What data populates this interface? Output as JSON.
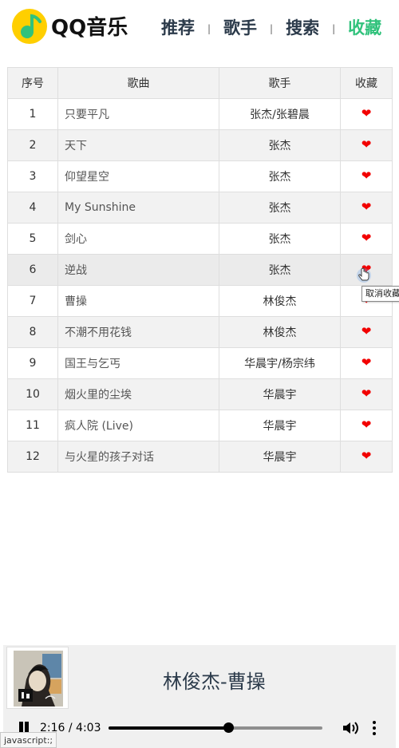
{
  "header": {
    "brand": "QQ音乐",
    "nav": [
      {
        "label": "推荐",
        "active": false
      },
      {
        "label": "歌手",
        "active": false
      },
      {
        "label": "搜索",
        "active": false
      },
      {
        "label": "收藏",
        "active": true
      }
    ],
    "separator": "|"
  },
  "colors": {
    "accent": "#31c27c",
    "heart": "#f20000",
    "nav_text": "#2b3a4a",
    "logo_yellow": "#ffcf00",
    "logo_green": "#31c27c"
  },
  "table": {
    "headers": [
      "序号",
      "歌曲",
      "歌手",
      "收藏"
    ],
    "rows": [
      {
        "no": "1",
        "song": "只要平凡",
        "artist": "张杰/张碧晨",
        "fav": "❤"
      },
      {
        "no": "2",
        "song": "天下",
        "artist": "张杰",
        "fav": "❤"
      },
      {
        "no": "3",
        "song": "仰望星空",
        "artist": "张杰",
        "fav": "❤"
      },
      {
        "no": "4",
        "song": "My Sunshine",
        "artist": "张杰",
        "fav": "❤"
      },
      {
        "no": "5",
        "song": "剑心",
        "artist": "张杰",
        "fav": "❤"
      },
      {
        "no": "6",
        "song": "逆战",
        "artist": "张杰",
        "fav": "❤"
      },
      {
        "no": "7",
        "song": "曹操",
        "artist": "林俊杰",
        "fav": "❤"
      },
      {
        "no": "8",
        "song": "不潮不用花钱",
        "artist": "林俊杰",
        "fav": "❤"
      },
      {
        "no": "9",
        "song": "国王与乞丐",
        "artist": "华晨宇/杨宗纬",
        "fav": "❤"
      },
      {
        "no": "10",
        "song": "烟火里的尘埃",
        "artist": "华晨宇",
        "fav": "❤"
      },
      {
        "no": "11",
        "song": "疯人院 (Live)",
        "artist": "华晨宇",
        "fav": "❤"
      },
      {
        "no": "12",
        "song": "与火星的孩子对话",
        "artist": "华晨宇",
        "fav": "❤"
      }
    ],
    "hover_row_index": 5
  },
  "tooltip": {
    "text": "取消收藏"
  },
  "player": {
    "now_playing": "林俊杰-曹操",
    "time": "2:16 / 4:03",
    "progress": 0.56,
    "state": "playing"
  },
  "status_bar": {
    "url": "javascript:;"
  },
  "icons": {
    "logo": "qq-music-logo-icon",
    "pause": "pause-icon",
    "volume": "volume-icon",
    "more": "more-vertical-icon",
    "heart": "heart-icon",
    "cursor": "hand-cursor-icon"
  }
}
